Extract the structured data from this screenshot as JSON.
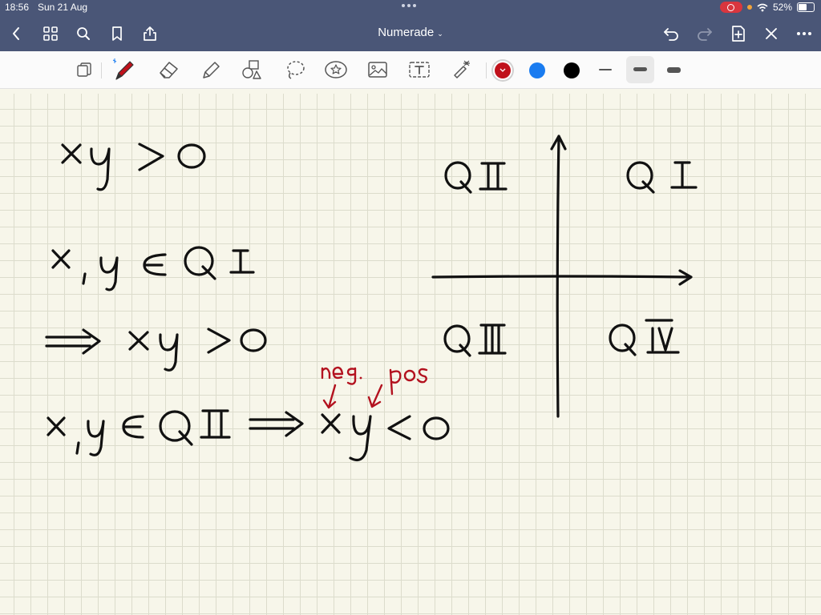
{
  "status_bar": {
    "time": "18:56",
    "date": "Sun 21 Aug",
    "battery": "52%",
    "battery_level": 0.52
  },
  "document": {
    "title": "Numerade",
    "title_caret": "⌄"
  },
  "toolbar": {
    "tools": [
      "document-pages-icon",
      "pen-icon",
      "eraser-icon",
      "highlighter-icon",
      "shapes-icon",
      "lasso-icon",
      "sticker-icon",
      "image-icon",
      "text-icon",
      "laser-pointer-icon"
    ],
    "colors": [
      {
        "name": "red",
        "hex": "#c0111b",
        "selected": true
      },
      {
        "name": "blue",
        "hex": "#1a7cf0",
        "selected": false
      },
      {
        "name": "black",
        "hex": "#000000",
        "selected": false
      }
    ],
    "stroke_widths": [
      "thin",
      "medium",
      "thick"
    ],
    "selected_stroke": "medium"
  },
  "colors": {
    "chrome": "#4a5677",
    "ink": "#111111",
    "annotation_ink": "#b3121f",
    "paper": "#f7f6ea",
    "grid": "#dcdccc"
  },
  "handwriting": {
    "line1": "xy > 0",
    "line2": "x, y ∈ Q I",
    "line3": "⟹ xy > 0",
    "line4": "x, y ∈ Q II ⟹ xy < 0",
    "annotation_neg": "neg.",
    "annotation_pos": "pos",
    "quadrant_1": "Q I",
    "quadrant_2": "Q II",
    "quadrant_3": "Q III",
    "quadrant_4": "Q IV"
  }
}
